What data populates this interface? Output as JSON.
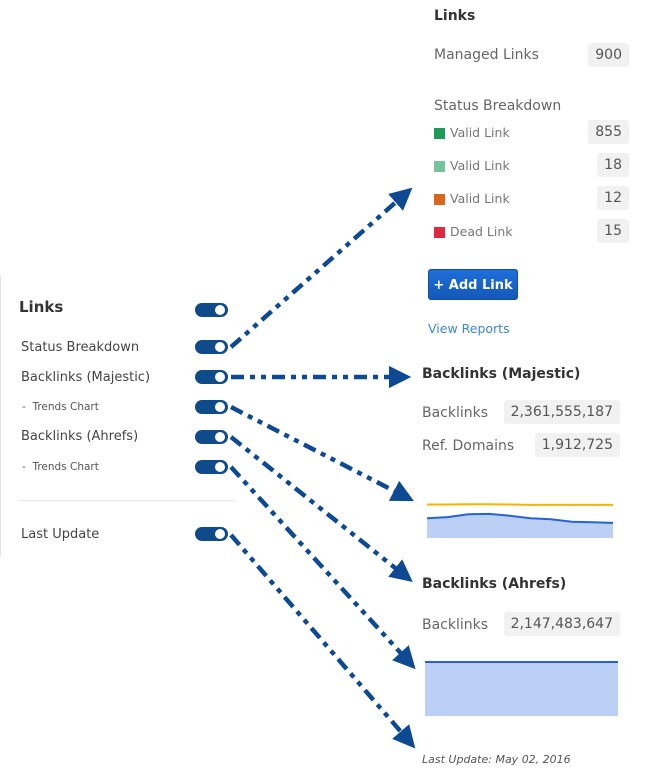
{
  "settings_panel": {
    "title": "Links",
    "items": [
      {
        "label": "Status Breakdown",
        "enabled": true
      },
      {
        "label": "Backlinks (Majestic)",
        "enabled": true
      },
      {
        "label": "-  Trends Chart",
        "enabled": true
      },
      {
        "label": "Backlinks (Ahrefs)",
        "enabled": true
      },
      {
        "label": "-  Trends Chart",
        "enabled": true
      },
      {
        "label": "Last Update",
        "enabled": true
      }
    ],
    "title_enabled": true
  },
  "preview": {
    "links": {
      "title": "Links",
      "managed_label": "Managed Links",
      "managed_value": "900",
      "status_title": "Status Breakdown",
      "statuses": [
        {
          "label": "Valid Link",
          "value": "855",
          "color": "#1f9a57"
        },
        {
          "label": "Valid Link",
          "value": "18",
          "color": "#74c39a"
        },
        {
          "label": "Valid Link",
          "value": "12",
          "color": "#d9661a"
        },
        {
          "label": "Dead Link",
          "value": "15",
          "color": "#dc2a45"
        }
      ],
      "add_button": "+ Add Link",
      "view_reports": "View Reports"
    },
    "majestic": {
      "title": "Backlinks (Majestic)",
      "backlinks_label": "Backlinks",
      "backlinks_value": "2,361,555,187",
      "ref_domains_label": "Ref. Domains",
      "ref_domains_value": "1,912,725"
    },
    "ahrefs": {
      "title": "Backlinks (Ahrefs)",
      "backlinks_label": "Backlinks",
      "backlinks_value": "2,147,483,647"
    },
    "last_update": "Last Update: May 02, 2016"
  },
  "colors": {
    "toggle_on": "#0f4a8a",
    "arrow": "#0e4a94",
    "trend_blue": "#2563d6",
    "trend_fill": "#bccff5",
    "trend_yellow": "#f5b400"
  },
  "chart_data": [
    {
      "type": "area",
      "title": "Backlinks (Majestic) Trends",
      "series": [
        {
          "name": "line-yellow",
          "values": [
            0.93,
            0.93,
            0.94,
            0.94,
            0.93,
            0.92,
            0.92,
            0.92,
            0.92,
            0.92
          ]
        },
        {
          "name": "area-blue",
          "values": [
            0.55,
            0.58,
            0.66,
            0.67,
            0.62,
            0.55,
            0.52,
            0.45,
            0.44,
            0.42
          ]
        }
      ],
      "ylim": [
        0,
        1
      ]
    },
    {
      "type": "area",
      "title": "Backlinks (Ahrefs) Trends",
      "series": [
        {
          "name": "area-blue",
          "values": [
            1,
            1,
            1,
            1,
            1,
            1,
            1,
            1,
            1,
            1
          ]
        }
      ],
      "ylim": [
        0,
        1
      ]
    }
  ]
}
